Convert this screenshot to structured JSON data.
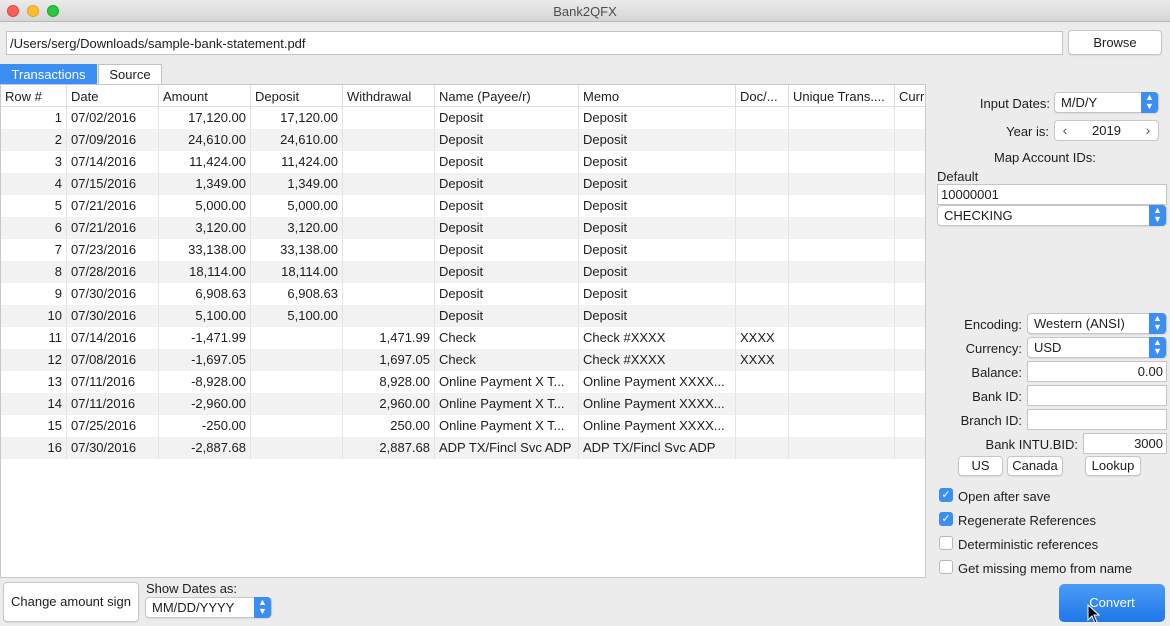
{
  "window": {
    "title": "Bank2QFX"
  },
  "file": {
    "path": "/Users/serg/Downloads/sample-bank-statement.pdf",
    "browse_label": "Browse"
  },
  "tabs": [
    {
      "label": "Transactions",
      "active": true
    },
    {
      "label": "Source",
      "active": false
    }
  ],
  "table": {
    "headers": [
      "Row #",
      "Date",
      "Amount",
      "Deposit",
      "Withdrawal",
      "Name (Payee/r)",
      "Memo",
      "Doc/...",
      "Unique Trans....",
      "Curr"
    ],
    "rows": [
      [
        "1",
        "07/02/2016",
        "17,120.00",
        "17,120.00",
        "",
        "Deposit",
        "Deposit",
        "",
        "",
        ""
      ],
      [
        "2",
        "07/09/2016",
        "24,610.00",
        "24,610.00",
        "",
        "Deposit",
        "Deposit",
        "",
        "",
        ""
      ],
      [
        "3",
        "07/14/2016",
        "11,424.00",
        "11,424.00",
        "",
        "Deposit",
        "Deposit",
        "",
        "",
        ""
      ],
      [
        "4",
        "07/15/2016",
        "1,349.00",
        "1,349.00",
        "",
        "Deposit",
        "Deposit",
        "",
        "",
        ""
      ],
      [
        "5",
        "07/21/2016",
        "5,000.00",
        "5,000.00",
        "",
        "Deposit",
        "Deposit",
        "",
        "",
        ""
      ],
      [
        "6",
        "07/21/2016",
        "3,120.00",
        "3,120.00",
        "",
        "Deposit",
        "Deposit",
        "",
        "",
        ""
      ],
      [
        "7",
        "07/23/2016",
        "33,138.00",
        "33,138.00",
        "",
        "Deposit",
        "Deposit",
        "",
        "",
        ""
      ],
      [
        "8",
        "07/28/2016",
        "18,114.00",
        "18,114.00",
        "",
        "Deposit",
        "Deposit",
        "",
        "",
        ""
      ],
      [
        "9",
        "07/30/2016",
        "6,908.63",
        "6,908.63",
        "",
        "Deposit",
        "Deposit",
        "",
        "",
        ""
      ],
      [
        "10",
        "07/30/2016",
        "5,100.00",
        "5,100.00",
        "",
        "Deposit",
        "Deposit",
        "",
        "",
        ""
      ],
      [
        "11",
        "07/14/2016",
        "-1,471.99",
        "",
        "1,471.99",
        "Check",
        "Check #XXXX",
        "XXXX",
        "",
        ""
      ],
      [
        "12",
        "07/08/2016",
        "-1,697.05",
        "",
        "1,697.05",
        "Check",
        "Check #XXXX",
        "XXXX",
        "",
        ""
      ],
      [
        "13",
        "07/11/2016",
        "-8,928.00",
        "",
        "8,928.00",
        "Online Payment X T...",
        "Online Payment XXXX...",
        "",
        "",
        ""
      ],
      [
        "14",
        "07/11/2016",
        "-2,960.00",
        "",
        "2,960.00",
        "Online Payment X T...",
        "Online Payment XXXX...",
        "",
        "",
        ""
      ],
      [
        "15",
        "07/25/2016",
        "-250.00",
        "",
        "250.00",
        "Online Payment X T...",
        "Online Payment XXXX...",
        "",
        "",
        ""
      ],
      [
        "16",
        "07/30/2016",
        "-2,887.68",
        "",
        "2,887.68",
        "ADP TX/Fincl Svc ADP",
        "ADP TX/Fincl Svc ADP",
        "",
        "",
        ""
      ]
    ]
  },
  "settings": {
    "input_dates_label": "Input Dates:",
    "input_dates_value": "M/D/Y",
    "year_label": "Year is:",
    "year_value": "2019",
    "map_accounts_label": "Map Account IDs:",
    "default_label": "Default",
    "account_id": "10000001",
    "account_type": "CHECKING",
    "encoding_label": "Encoding:",
    "encoding_value": "Western (ANSI)",
    "currency_label": "Currency:",
    "currency_value": "USD",
    "balance_label": "Balance:",
    "balance_value": "0.00",
    "bank_id_label": "Bank ID:",
    "bank_id_value": "",
    "branch_id_label": "Branch ID:",
    "branch_id_value": "",
    "intu_label": "Bank INTU.BID:",
    "intu_value": "3000",
    "us_label": "US",
    "canada_label": "Canada",
    "lookup_label": "Lookup",
    "checkboxes": [
      {
        "label": "Open after save",
        "checked": true
      },
      {
        "label": "Regenerate References",
        "checked": true
      },
      {
        "label": "Deterministic references",
        "checked": false
      },
      {
        "label": "Get missing memo from name",
        "checked": false
      }
    ]
  },
  "bottom": {
    "change_sign_label": "Change amount sign",
    "show_dates_label": "Show Dates as:",
    "show_dates_value": "MM/DD/YYYY",
    "convert_label": "Convert"
  },
  "colors": {
    "accent": "#3b8ff2",
    "alt_row": "#f2f2f2"
  }
}
